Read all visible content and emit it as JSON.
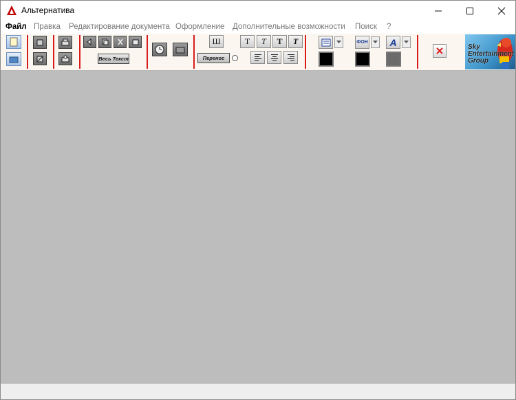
{
  "window": {
    "title": "Альтернатива"
  },
  "menu": [
    "Файл",
    "Правка",
    "Редактирование документа",
    "Оформление",
    "Дополнительные возможности",
    "Поиск",
    "?"
  ],
  "toolbar": {
    "all_text_label": "Весь Текст",
    "wrap_label": "Перенос",
    "strike_label": "Ш",
    "font_labels": [
      "T",
      "T",
      "T",
      "T"
    ],
    "fon_label": "ФОН",
    "font_color_label": "A",
    "logo_text": [
      "Sky",
      "Entertainment",
      "Group"
    ]
  },
  "colors": {
    "separator": "#d81b1b",
    "workspace": "#bdbdbd",
    "close_x": "#e02020"
  }
}
